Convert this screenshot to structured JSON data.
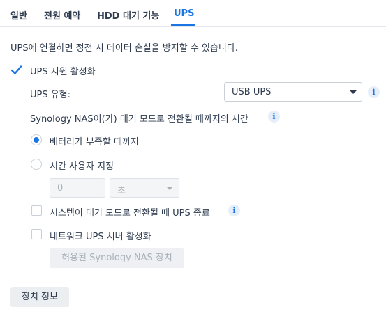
{
  "tabs": [
    {
      "label": "일반"
    },
    {
      "label": "전원 예약"
    },
    {
      "label": "HDD 대기 기능"
    },
    {
      "label": "UPS"
    }
  ],
  "description": "UPS에 연결하면 정전 시 데이터 손실을 방지할 수 있습니다.",
  "enable_ups": {
    "label": "UPS 지원 활성화",
    "checked": true
  },
  "ups_type": {
    "label": "UPS 유형:",
    "value": "USB UPS"
  },
  "standby_time": {
    "label": "Synology NAS이(가) 대기 모드로 전환될 때까지의 시간"
  },
  "radio_options": [
    {
      "label": "배터리가 부족할 때까지",
      "checked": true
    },
    {
      "label": "시간 사용자 지정",
      "checked": false
    }
  ],
  "custom_time": {
    "value": "0",
    "unit": "초"
  },
  "shutdown_ups": {
    "label": "시스템이 대기 모드로 전환될 때 UPS 종료",
    "checked": false
  },
  "network_ups": {
    "label": "네트워크 UPS 서버 활성화",
    "checked": false
  },
  "allowed_devices_button": "허용된 Synology NAS 장치",
  "device_info_button": "장치 정보",
  "colors": {
    "accent": "#1a75e5",
    "text": "#2e3b4e",
    "border": "#c9d0d8"
  }
}
